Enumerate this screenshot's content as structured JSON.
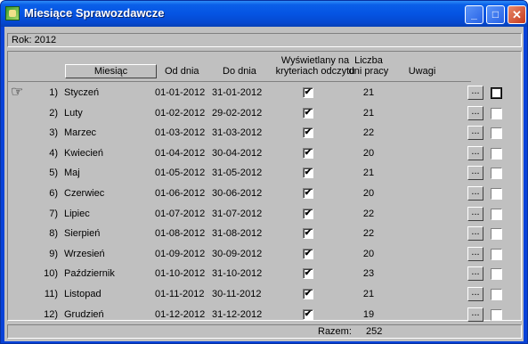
{
  "window": {
    "title": "Miesiące Sprawozdawcze",
    "minimize_glyph": "_",
    "maximize_glyph": "□",
    "close_glyph": "✕"
  },
  "year_label": "Rok: 2012",
  "columns": {
    "month": "Miesiąc",
    "from": "Od dnia",
    "to": "Do dnia",
    "shown_line1": "Wyświetlany na",
    "shown_line2": "kryteriach odczytu",
    "days_line1": "Liczba",
    "days_line2": "dni pracy",
    "notes": "Uwagi"
  },
  "rows": [
    {
      "num": "1)",
      "name": "Styczeń",
      "from": "01-01-2012",
      "to": "31-01-2012",
      "checked": "✔",
      "days": "21",
      "dots": "..."
    },
    {
      "num": "2)",
      "name": "Luty",
      "from": "01-02-2012",
      "to": "29-02-2012",
      "checked": "✔",
      "days": "21",
      "dots": "..."
    },
    {
      "num": "3)",
      "name": "Marzec",
      "from": "01-03-2012",
      "to": "31-03-2012",
      "checked": "✔",
      "days": "22",
      "dots": "..."
    },
    {
      "num": "4)",
      "name": "Kwiecień",
      "from": "01-04-2012",
      "to": "30-04-2012",
      "checked": "✔",
      "days": "20",
      "dots": "..."
    },
    {
      "num": "5)",
      "name": "Maj",
      "from": "01-05-2012",
      "to": "31-05-2012",
      "checked": "✔",
      "days": "21",
      "dots": "..."
    },
    {
      "num": "6)",
      "name": "Czerwiec",
      "from": "01-06-2012",
      "to": "30-06-2012",
      "checked": "✔",
      "days": "20",
      "dots": "..."
    },
    {
      "num": "7)",
      "name": "Lipiec",
      "from": "01-07-2012",
      "to": "31-07-2012",
      "checked": "✔",
      "days": "22",
      "dots": "..."
    },
    {
      "num": "8)",
      "name": "Sierpień",
      "from": "01-08-2012",
      "to": "31-08-2012",
      "checked": "✔",
      "days": "22",
      "dots": "..."
    },
    {
      "num": "9)",
      "name": "Wrzesień",
      "from": "01-09-2012",
      "to": "30-09-2012",
      "checked": "✔",
      "days": "20",
      "dots": "..."
    },
    {
      "num": "10)",
      "name": "Październik",
      "from": "01-10-2012",
      "to": "31-10-2012",
      "checked": "✔",
      "days": "23",
      "dots": "..."
    },
    {
      "num": "11)",
      "name": "Listopad",
      "from": "01-11-2012",
      "to": "30-11-2012",
      "checked": "✔",
      "days": "21",
      "dots": "..."
    },
    {
      "num": "12)",
      "name": "Grudzień",
      "from": "01-12-2012",
      "to": "31-12-2012",
      "checked": "✔",
      "days": "19",
      "dots": "..."
    }
  ],
  "current_row_pointer": "☞",
  "footer": {
    "total_label": "Razem:",
    "total_value": "252"
  }
}
